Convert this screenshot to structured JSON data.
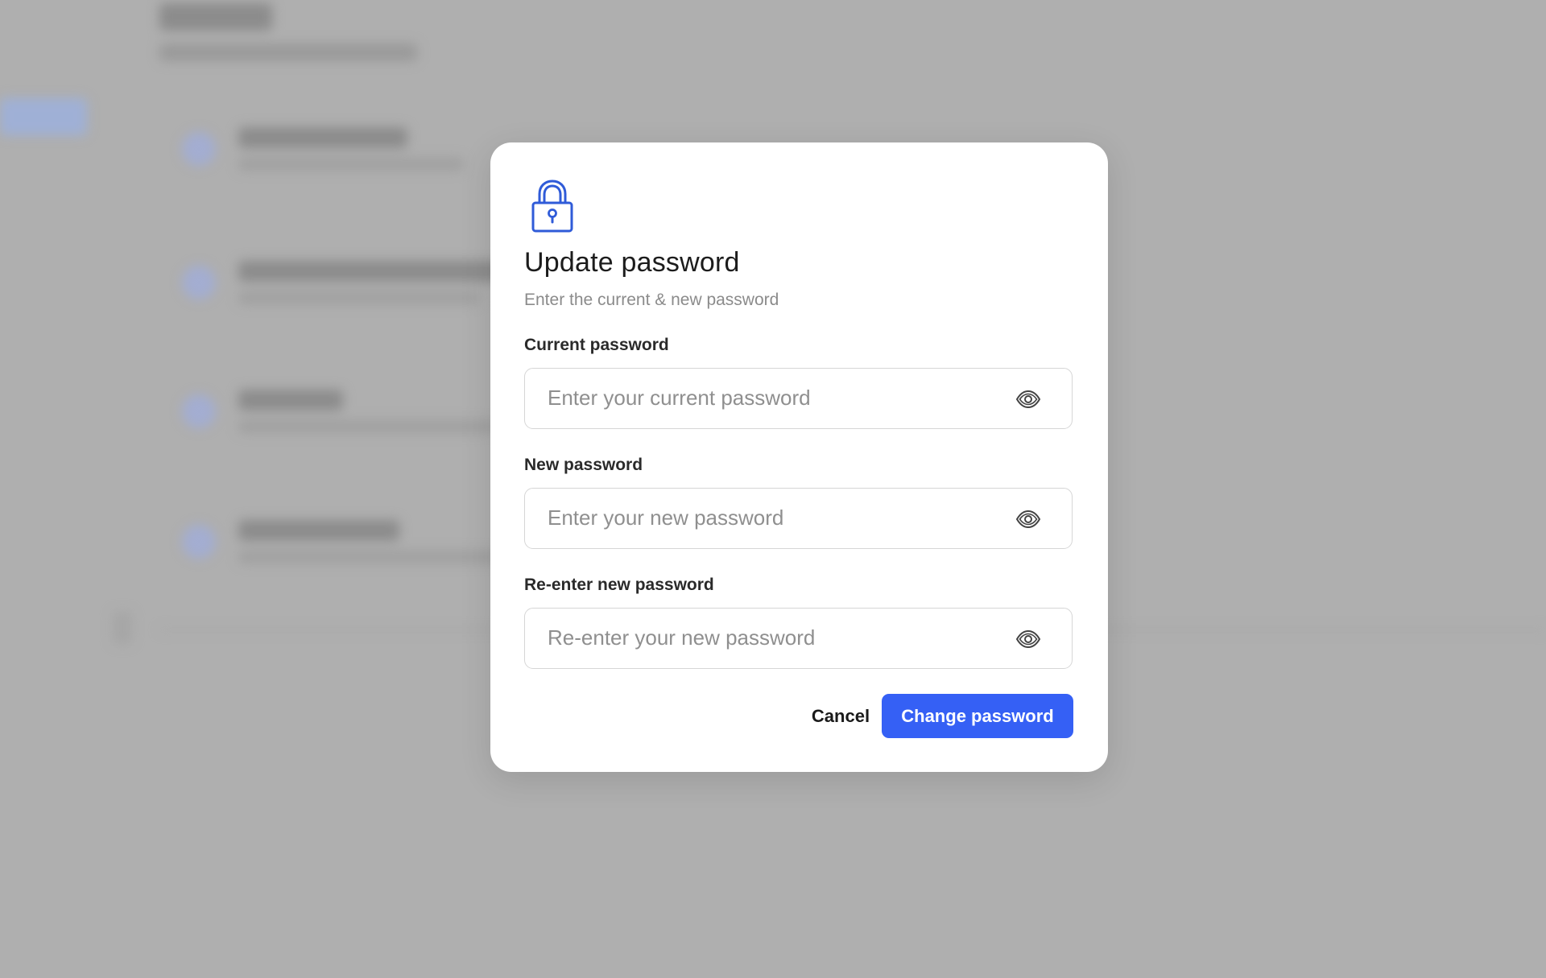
{
  "modal": {
    "title": "Update password",
    "subtitle": "Enter the current & new password",
    "icon": "lock-icon",
    "accent_color": "#3560f5"
  },
  "fields": [
    {
      "label": "Current password",
      "placeholder": "Enter your current password",
      "value": "",
      "toggle_icon": "eye-icon"
    },
    {
      "label": "New password",
      "placeholder": "Enter your new password",
      "value": "",
      "toggle_icon": "eye-icon"
    },
    {
      "label": "Re-enter new password",
      "placeholder": "Re-enter your new password",
      "value": "",
      "toggle_icon": "eye-icon"
    }
  ],
  "actions": {
    "cancel_label": "Cancel",
    "submit_label": "Change password"
  }
}
